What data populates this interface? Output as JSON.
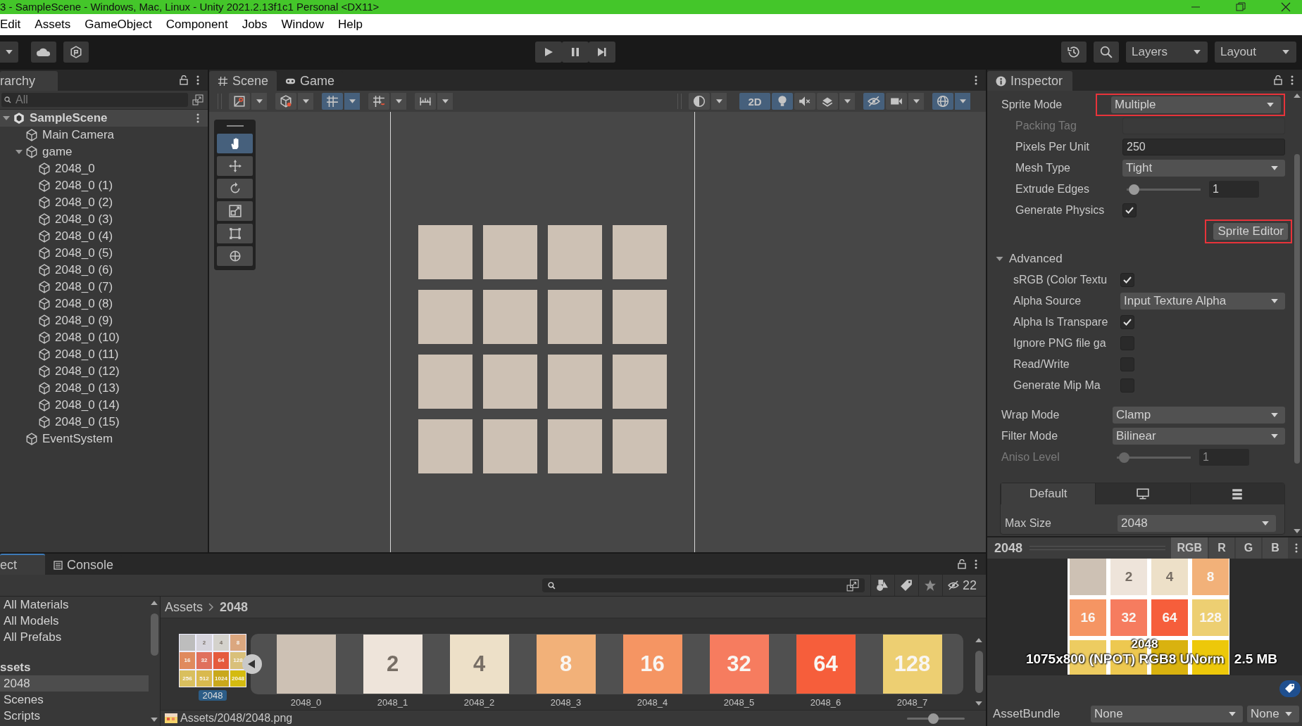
{
  "window": {
    "title": "3 - SampleScene - Windows, Mac, Linux - Unity 2021.2.13f1c1 Personal <DX11>"
  },
  "menu": [
    "Edit",
    "Assets",
    "GameObject",
    "Component",
    "Jobs",
    "Window",
    "Help"
  ],
  "toolbar": {
    "layers": "Layers",
    "layout": "Layout"
  },
  "hierarchy": {
    "tab": "rarchy",
    "search": {
      "placeholder": "All"
    },
    "tree": [
      {
        "label": "SampleScene",
        "kind": "scene",
        "expanded": true,
        "children": [
          {
            "label": "Main Camera",
            "kind": "object"
          },
          {
            "label": "game",
            "kind": "object",
            "expanded": true,
            "children": [
              {
                "label": "2048_0",
                "kind": "object"
              },
              {
                "label": "2048_0 (1)",
                "kind": "object"
              },
              {
                "label": "2048_0 (2)",
                "kind": "object"
              },
              {
                "label": "2048_0 (3)",
                "kind": "object"
              },
              {
                "label": "2048_0 (4)",
                "kind": "object"
              },
              {
                "label": "2048_0 (5)",
                "kind": "object"
              },
              {
                "label": "2048_0 (6)",
                "kind": "object"
              },
              {
                "label": "2048_0 (7)",
                "kind": "object"
              },
              {
                "label": "2048_0 (8)",
                "kind": "object"
              },
              {
                "label": "2048_0 (9)",
                "kind": "object"
              },
              {
                "label": "2048_0 (10)",
                "kind": "object"
              },
              {
                "label": "2048_0 (11)",
                "kind": "object"
              },
              {
                "label": "2048_0 (12)",
                "kind": "object"
              },
              {
                "label": "2048_0 (13)",
                "kind": "object"
              },
              {
                "label": "2048_0 (14)",
                "kind": "object"
              },
              {
                "label": "2048_0 (15)",
                "kind": "object"
              }
            ]
          },
          {
            "label": "EventSystem",
            "kind": "object"
          }
        ]
      }
    ]
  },
  "scene_view": {
    "tabs": [
      {
        "label": "Scene",
        "kind": "scene",
        "selected": true
      },
      {
        "label": "Game",
        "kind": "game",
        "selected": false
      }
    ],
    "left_tools": [
      {
        "kind": "tool-handle",
        "on": false,
        "caret": true
      },
      {
        "kind": "component",
        "on": false,
        "caret": true
      },
      {
        "kind": "grid-snap",
        "on": true,
        "caret": true
      },
      {
        "kind": "increment-snap",
        "on": false,
        "caret": true
      },
      {
        "kind": "ruler",
        "on": false,
        "caret": true
      }
    ],
    "right_tools": [
      {
        "kind": "render",
        "on": false,
        "caret": true
      },
      {
        "kind": "mode",
        "label": "2D",
        "on": true,
        "caret": false
      },
      {
        "kind": "light",
        "on": true,
        "caret": false
      },
      {
        "kind": "audio",
        "on": false,
        "caret": false
      },
      {
        "kind": "effects",
        "on": false,
        "caret": true
      },
      {
        "kind": "hidden",
        "on": true,
        "caret": false
      },
      {
        "kind": "camera",
        "on": false,
        "caret": true
      },
      {
        "kind": "gizmos",
        "on": true,
        "caret": true
      }
    ],
    "transform_tools": [
      {
        "kind": "hand",
        "selected": true
      },
      {
        "kind": "move",
        "selected": false
      },
      {
        "kind": "rotate",
        "selected": false
      },
      {
        "kind": "scale",
        "selected": false
      },
      {
        "kind": "rect",
        "selected": false
      },
      {
        "kind": "transform",
        "selected": false
      }
    ]
  },
  "inspector": {
    "tab": "Inspector",
    "sprite_mode": {
      "label": "Sprite Mode",
      "value": "Multiple",
      "highlighted": true
    },
    "sprite_settings": [
      {
        "kind": "field",
        "label": "Packing Tag",
        "disabled": true
      },
      {
        "kind": "field",
        "label": "Pixels Per Unit",
        "value": "250",
        "disabled": false
      },
      {
        "kind": "dropdown",
        "label": "Mesh Type",
        "value": "Tight",
        "disabled": false
      },
      {
        "kind": "slider",
        "label": "Extrude Edges",
        "level": 0.03,
        "value": "1",
        "disabled": false
      },
      {
        "kind": "checkbox",
        "label": "Generate Physics",
        "checked": true,
        "disabled": false
      }
    ],
    "sprite_editor": {
      "label": "Sprite Editor",
      "highlighted": true
    },
    "advanced": {
      "label": "Advanced",
      "expanded": true,
      "rows": [
        {
          "kind": "checkbox",
          "label": "sRGB (Color Textu",
          "checked": true,
          "disabled": false
        },
        {
          "kind": "dropdown",
          "label": "Alpha Source",
          "value": "Input Texture Alpha",
          "disabled": false
        },
        {
          "kind": "checkbox",
          "label": "Alpha Is Transpare",
          "checked": true,
          "disabled": false
        },
        {
          "kind": "checkbox",
          "label": "Ignore PNG file ga",
          "checked": false,
          "disabled": false
        },
        {
          "kind": "checkbox",
          "label": "Read/Write",
          "checked": false,
          "disabled": false
        },
        {
          "kind": "checkbox",
          "label": "Generate Mip Ma",
          "checked": false,
          "disabled": false
        }
      ]
    },
    "sampling": [
      {
        "kind": "dropdown",
        "label": "Wrap Mode",
        "value": "Clamp",
        "disabled": false
      },
      {
        "kind": "dropdown",
        "label": "Filter Mode",
        "value": "Bilinear",
        "disabled": false
      },
      {
        "kind": "slider",
        "label": "Aniso Level",
        "level": 0.03,
        "value": "1",
        "disabled": true
      }
    ],
    "platform_tabs": [
      {
        "kind": "default",
        "label": "Default",
        "selected": true
      },
      {
        "kind": "standalone",
        "selected": false
      },
      {
        "kind": "android",
        "selected": false
      }
    ],
    "max_size": {
      "label": "Max Size",
      "value": "2048"
    },
    "preview": {
      "title": "2048",
      "channels": [
        {
          "label": "RGB",
          "selected": true
        },
        {
          "label": "R",
          "selected": false
        },
        {
          "label": "G",
          "selected": false
        },
        {
          "label": "B",
          "selected": false
        }
      ],
      "tiles": [
        {
          "color": "#cdc1b4"
        },
        {
          "label": "2",
          "color": "#eee4da",
          "dark_text": true
        },
        {
          "label": "4",
          "color": "#ede0c8",
          "dark_text": true
        },
        {
          "label": "8",
          "color": "#f2b179",
          "dark_text": false
        },
        {
          "label": "16",
          "color": "#f59563",
          "dark_text": false
        },
        {
          "label": "32",
          "color": "#f67c5f",
          "dark_text": false
        },
        {
          "label": "64",
          "color": "#f65e3b",
          "dark_text": false
        },
        {
          "label": "128",
          "color": "#edcf72",
          "dark_text": false
        },
        {
          "color": "#edcc61"
        },
        {
          "color": "#edc850"
        },
        {
          "color": "#d9b20f"
        },
        {
          "color": "#edc80a"
        }
      ],
      "name": "2048",
      "info": "1075x800 (NPOT)  RGB8 UNorm",
      "size": "2.5 MB"
    },
    "asset_bundle": {
      "label": "AssetBundle",
      "value": "None",
      "variant": "None"
    }
  },
  "project": {
    "tabs": [
      {
        "label": "ect",
        "selected": true
      },
      {
        "label": "Console",
        "selected": false
      }
    ],
    "hidden_count": "22",
    "favorites": [
      "All Materials",
      "All Models",
      "All Prefabs"
    ],
    "assets": {
      "label": "ssets",
      "children": [
        {
          "label": "2048",
          "selected": true
        },
        {
          "label": "Scenes",
          "selected": false
        },
        {
          "label": "Scripts",
          "selected": false
        }
      ]
    },
    "breadcrumb": [
      "Assets",
      "2048"
    ],
    "sheet": {
      "name": "2048",
      "selected": true,
      "tiles": [
        {
          "color": "#bdbdbd"
        },
        {
          "label": "2",
          "color": "#d6d4dc",
          "dark_text": true
        },
        {
          "label": "4",
          "color": "#d4d2cc",
          "dark_text": true
        },
        {
          "label": "8",
          "color": "#dba77f",
          "dark_text": false
        },
        {
          "label": "16",
          "color": "#e08a5e",
          "dark_text": false
        },
        {
          "label": "32",
          "color": "#e0705e",
          "dark_text": false
        },
        {
          "label": "64",
          "color": "#e55a3e",
          "dark_text": false
        },
        {
          "label": "128",
          "color": "#d9c07a",
          "dark_text": false
        },
        {
          "label": "256",
          "color": "#d9bf5e",
          "dark_text": false
        },
        {
          "label": "512",
          "color": "#d9b94e",
          "dark_text": false
        },
        {
          "label": "1024",
          "color": "#c9a81c",
          "dark_text": false
        },
        {
          "label": "2048",
          "color": "#d4bb10",
          "dark_text": false
        }
      ]
    },
    "sprites": [
      {
        "name": "2048_0",
        "color": "#cdc1b4"
      },
      {
        "name": "2048_1",
        "label": "2",
        "color": "#eee4da",
        "dark_text": true
      },
      {
        "name": "2048_2",
        "label": "4",
        "color": "#ede0c8",
        "dark_text": true
      },
      {
        "name": "2048_3",
        "label": "8",
        "color": "#f2b179",
        "dark_text": false
      },
      {
        "name": "2048_4",
        "label": "16",
        "color": "#f59563",
        "dark_text": false
      },
      {
        "name": "2048_5",
        "label": "32",
        "color": "#f67c5f",
        "dark_text": false
      },
      {
        "name": "2048_6",
        "label": "64",
        "color": "#f65e3b",
        "dark_text": false
      },
      {
        "name": "2048_7",
        "label": "128",
        "color": "#edcf72",
        "dark_text": false
      }
    ],
    "status": "Assets/2048/2048.png",
    "zoom": {
      "level": 0.45
    }
  }
}
